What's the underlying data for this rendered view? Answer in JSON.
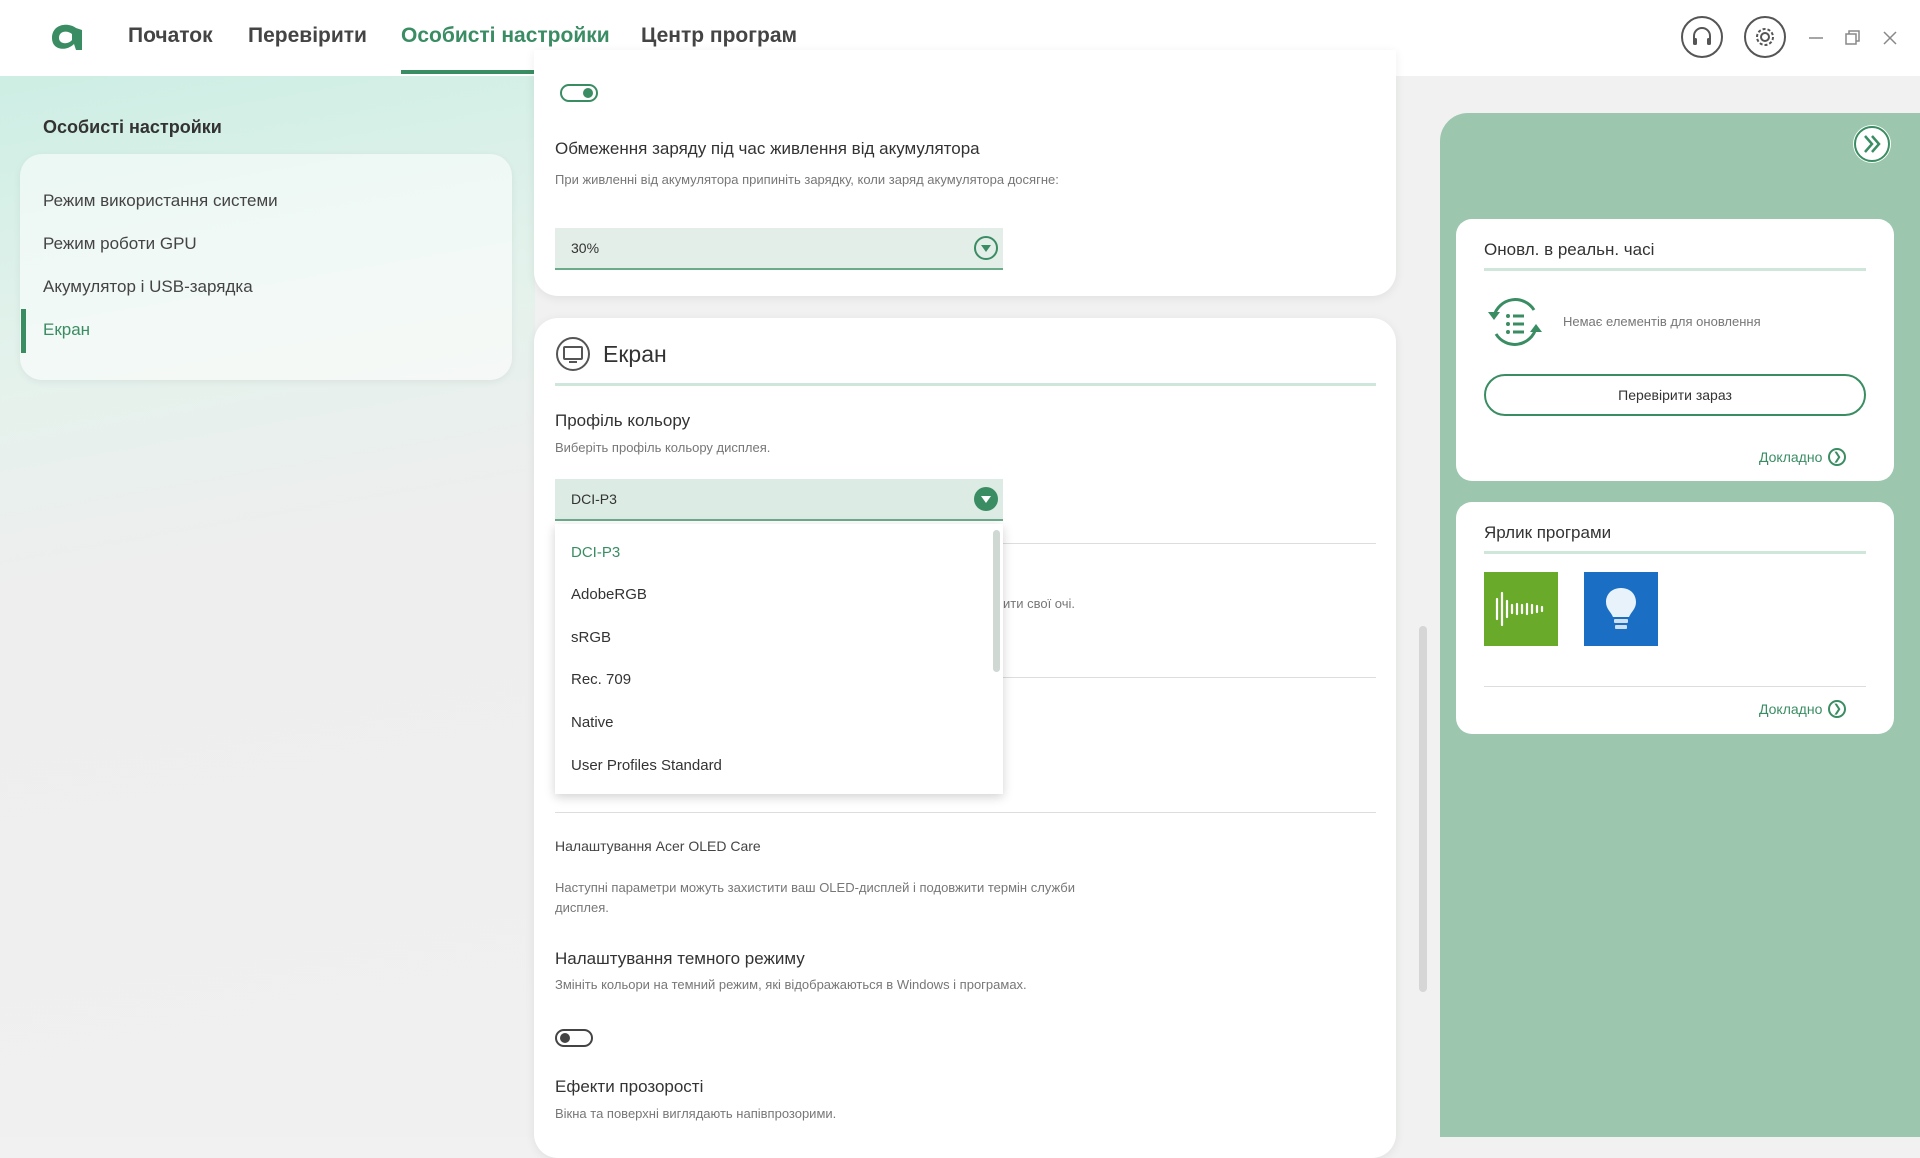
{
  "header": {
    "tabs": [
      "Початок",
      "Перевірити",
      "Особисті настройки",
      "Центр програм"
    ],
    "active_tab_index": 2
  },
  "sidebar": {
    "title": "Особисті настройки",
    "items": [
      "Режим використання системи",
      "Режим роботи GPU",
      "Акумулятор і USB-зарядка",
      "Екран"
    ],
    "active_index": 3
  },
  "battery": {
    "toggle_on": true,
    "charge_limit_title": "Обмеження заряду під час живлення від акумулятора",
    "charge_limit_desc": "При живленні від акумулятора припиніть зарядку, коли заряд акумулятора досягне:",
    "charge_limit_value": "30%"
  },
  "screen": {
    "section_title": "Екран",
    "color_profile_title": "Профіль кольору",
    "color_profile_desc": "Виберіть профіль кольору дисплея.",
    "color_profile_value": "DCI-P3",
    "color_profile_options": [
      "DCI-P3",
      "AdobeRGB",
      "sRGB",
      "Rec. 709",
      "Native",
      "User Profiles Standard"
    ],
    "partial_hidden_text": "ити свої очі.",
    "oled_title": "Налаштування Acer OLED Care",
    "oled_desc": "Наступні параметри можуть захистити ваш OLED-дисплей і подовжити термін служби дисплея.",
    "dark_mode_title": "Налаштування темного режиму",
    "dark_mode_desc": "Змініть кольори на темний режим, які відображаються в Windows і програмах.",
    "dark_mode_on": false,
    "transparency_title": "Ефекти прозорості",
    "transparency_desc": "Вікна та поверхні виглядають напівпрозорими."
  },
  "right_panel": {
    "updates_title": "Оновл. в реальн. часі",
    "updates_empty": "Немає елементів для оновлення",
    "check_now": "Перевірити зараз",
    "more_label": "Докладно",
    "shortcuts_title": "Ярлик програми",
    "more_label_2": "Докладно"
  },
  "colors": {
    "accent": "#3a8d63",
    "right_panel_bg": "#9cc7ae",
    "shortcut_green": "#6aaa2a",
    "shortcut_blue": "#1a6fc4"
  },
  "icons": [
    "acer-logo-icon",
    "headset-icon",
    "gear-icon",
    "minimize-icon",
    "restore-icon",
    "close-icon",
    "dropdown-arrow-icon",
    "monitor-icon",
    "collapse-chevrons-icon",
    "refresh-list-icon",
    "chevron-right-icon",
    "audio-wave-app-icon",
    "lightbulb-app-icon"
  ]
}
